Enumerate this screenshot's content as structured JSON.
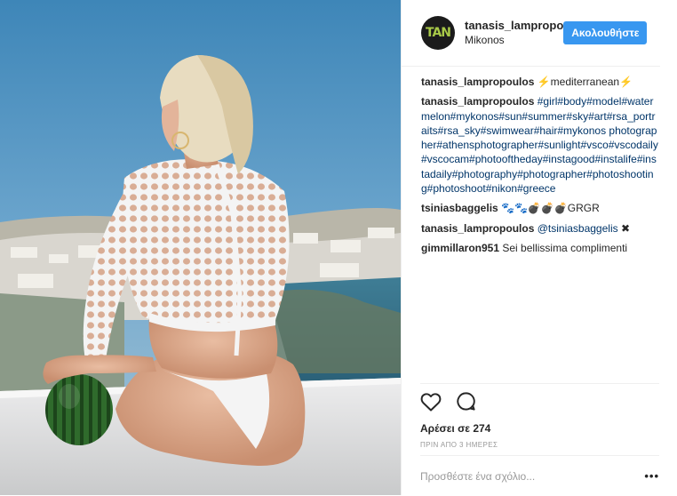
{
  "header": {
    "avatar_text": "TAN",
    "username": "tanasis_lampropo",
    "location": "Mikonos",
    "follow_label": "Ακολουθήστε"
  },
  "comments": [
    {
      "user": "tanasis_lampropoulos",
      "text": "⚡mediterranean⚡",
      "is_tags": false
    },
    {
      "user": "tanasis_lampropoulos",
      "text": "#girl#body#model#watermelon#mykonos#sun#summer#sky#art#rsa_portraits#rsa_sky#swimwear#hair#mykonos photographer#athensphotographer#sunlight#vsco#vscodaily#vscocam#photooftheday#instagood#instalife#instadaily#photography#photographer#photoshooting#photoshoot#nikon#greece",
      "is_tags": true
    },
    {
      "user": "tsiniasbaggelis",
      "text": "🐾🐾💣💣💣GRGR",
      "is_tags": false
    },
    {
      "user": "tanasis_lampropoulos",
      "text": "@tsiniasbaggelis",
      "suffix": "✖",
      "is_tags": true
    },
    {
      "user": "gimmillaron951",
      "text": "Sei bellissima complimenti",
      "is_tags": false
    }
  ],
  "actions": {
    "likes": "Αρέσει σε 274",
    "time": "ΠΡΙΝ ΑΠΟ 3 ΗΜΕΡΕΣ"
  },
  "add_comment": {
    "placeholder": "Προσθέστε ένα σχόλιο...",
    "more": "•••"
  },
  "colors": {
    "accent": "#3897f0",
    "link": "#003569",
    "avatar_bg": "#1b1b1b",
    "avatar_fg": "#a8c948"
  },
  "icons": [
    "heart-icon",
    "comment-icon",
    "more-options-icon"
  ]
}
